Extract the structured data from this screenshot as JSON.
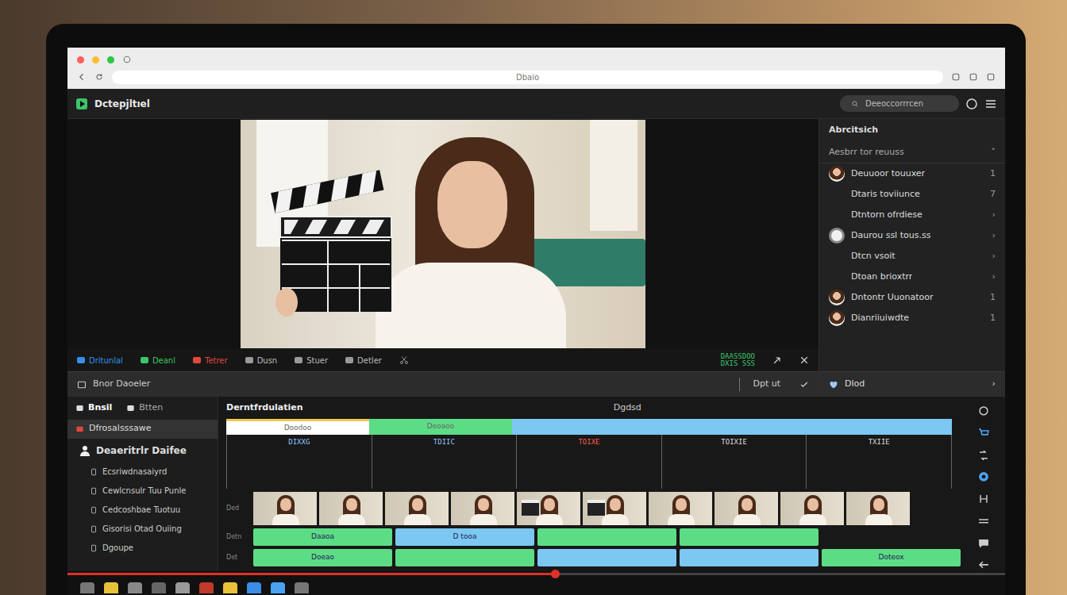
{
  "browser": {
    "address": "Dbaio"
  },
  "app": {
    "title": "Dctepjltıel",
    "search": "Deeoccorrrcen"
  },
  "preview_tools": [
    {
      "label": "Dritunlal",
      "color": "#3a8ee6"
    },
    {
      "label": "Deanl",
      "color": "#3cc46a"
    },
    {
      "label": "Tetrer",
      "color": "#e0483e"
    },
    {
      "label": "Dusn",
      "color": "#9a9a9a"
    },
    {
      "label": "Stuer",
      "color": "#9a9a9a"
    },
    {
      "label": "Detler",
      "color": "#9a9a9a"
    }
  ],
  "timecode": [
    "DAASSDOO",
    "DXIS SSS"
  ],
  "clip_bar": {
    "title": "Bnor Daoeler",
    "action": "Dpt ut"
  },
  "sidebar": {
    "title": "Abrcitsich",
    "filter": "Aesbrr tor reuuss",
    "filter_mark": "˅",
    "items": [
      {
        "label": "Deuuoor touuxer",
        "kind": "avatar",
        "end": "1"
      },
      {
        "label": "Dtaris toviiunce",
        "kind": "plain",
        "end": "7"
      },
      {
        "label": "Dtntorn ofrdiese",
        "kind": "plain",
        "end": "›"
      },
      {
        "label": "Daurou ssl tous.ss",
        "kind": "logo",
        "end": "›"
      },
      {
        "label": "Dtcn vsoit",
        "kind": "plain",
        "end": "›"
      },
      {
        "label": "Dtoan brioxtrr",
        "kind": "plain",
        "end": "›"
      },
      {
        "label": "Dntontr Uuonatoor",
        "kind": "avatar",
        "end": "1"
      },
      {
        "label": "Dianriiuiwdte",
        "kind": "avatar",
        "end": "1"
      }
    ],
    "button": "Dlod",
    "button_mark": "›"
  },
  "project": {
    "tabs": [
      {
        "label": "Bnsil",
        "selected": true
      },
      {
        "label": "Btten",
        "selected": false
      }
    ],
    "items": [
      {
        "label": "Dfrosalsssawe",
        "kind": "folder",
        "selected": true
      },
      {
        "label": "Deaeritrlr Daifee",
        "kind": "heading",
        "selected": false
      },
      {
        "label": "Ecsriwdnasaiyrd",
        "kind": "entry",
        "selected": false
      },
      {
        "label": "Cewlcnsulr Tuu Punle",
        "kind": "entry",
        "selected": false
      },
      {
        "label": "Cedcoshbae Tuotuu",
        "kind": "entry",
        "selected": false
      },
      {
        "label": "Gisorisi Otad Ouiing",
        "kind": "entry",
        "selected": false
      },
      {
        "label": "Dgoupe",
        "kind": "entry",
        "selected": false
      }
    ]
  },
  "timeline": {
    "title": "Derntfrdulatien",
    "center": "Dgdsd",
    "segments": [
      {
        "label": "Doodoo",
        "color": "#ffffff",
        "kind": "first"
      },
      {
        "label": "Deoaoo",
        "color": "#5ddc86",
        "kind": "fixed"
      },
      {
        "color": "#7cc8f2",
        "kind": "rest"
      }
    ],
    "ruler": [
      {
        "label": "DIXXG",
        "color": "#8ec5ff"
      },
      {
        "label": "TDIIC",
        "color": "#8ec5ff"
      },
      {
        "label": "TOIXE",
        "color": "#ff5a4e"
      },
      {
        "label": "TOIXIE",
        "color": "#dddddd"
      },
      {
        "label": "TXIIE",
        "color": "#dddddd"
      }
    ],
    "tracks": [
      {
        "label": "Ded",
        "kind": "video",
        "frames": [
          "person",
          "person",
          "person",
          "person",
          "clapper",
          "clapper",
          "person",
          "person",
          "person",
          "person"
        ]
      },
      {
        "label": "Detn",
        "kind": "clips",
        "clips": [
          {
            "label": "Daaoa",
            "color": "#5ddc86"
          },
          {
            "label": "D tooa",
            "color": "#7cc8f2"
          },
          {
            "color": "#5ddc86"
          },
          {
            "color": "#5ddc86"
          }
        ]
      },
      {
        "label": "Det",
        "kind": "clips",
        "clips": [
          {
            "label": "Doeao",
            "color": "#5ddc86"
          },
          {
            "color": "#5ddc86"
          },
          {
            "color": "#7cc8f2"
          },
          {
            "color": "#7cc8f2"
          },
          {
            "label": "Doteox",
            "color": "#5ddc86"
          }
        ]
      }
    ]
  },
  "playback": {
    "level": 0.52
  }
}
